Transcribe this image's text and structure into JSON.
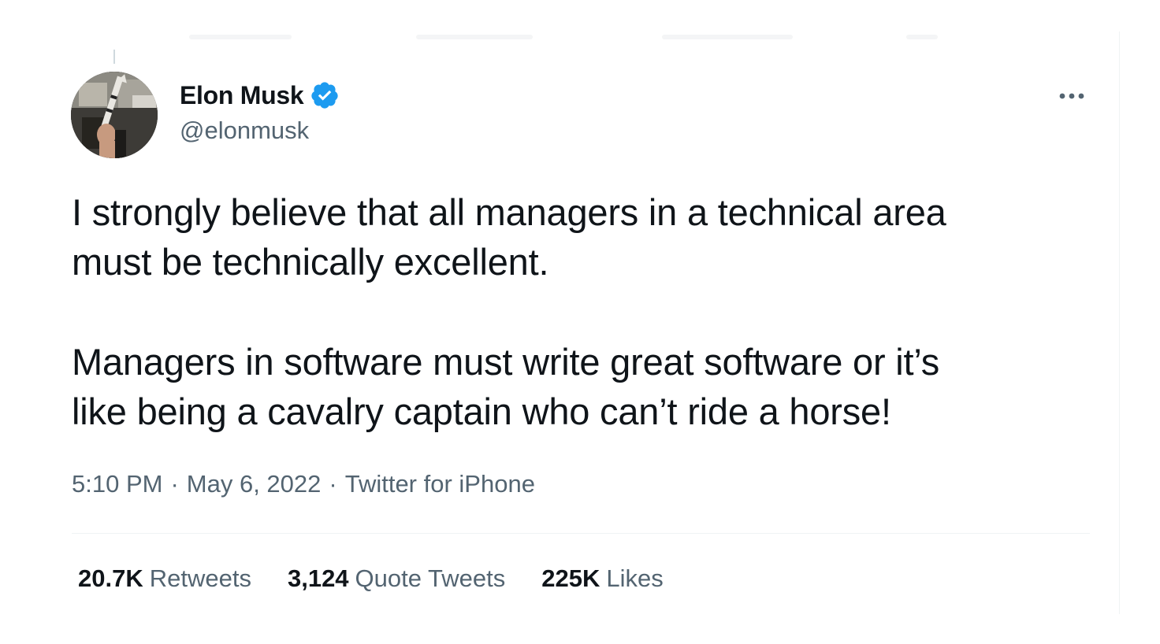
{
  "author": {
    "display_name": "Elon Musk",
    "handle": "@elonmusk",
    "verified": true,
    "verified_icon": "verified-badge-icon",
    "avatar_icon": "profile-avatar"
  },
  "tweet": {
    "paragraphs": [
      "I strongly believe that all managers in a technical area\nmust be technically excellent.",
      "Managers in software must write great software or it’s\nlike being a cavalry captain who can’t ride a horse!"
    ],
    "time": "5:10 PM",
    "date": "May 6, 2022",
    "separator": "·",
    "source": "Twitter for iPhone"
  },
  "stats": {
    "retweets_count": "20.7K",
    "retweets_label": "Retweets",
    "quotes_count": "3,124",
    "quotes_label": "Quote Tweets",
    "likes_count": "225K",
    "likes_label": "Likes"
  },
  "menu": {
    "more_icon": "more-options-icon"
  },
  "colors": {
    "text": "#0f1419",
    "secondary": "#536471",
    "verified": "#1d9bf0",
    "divider": "#eff3f4"
  }
}
